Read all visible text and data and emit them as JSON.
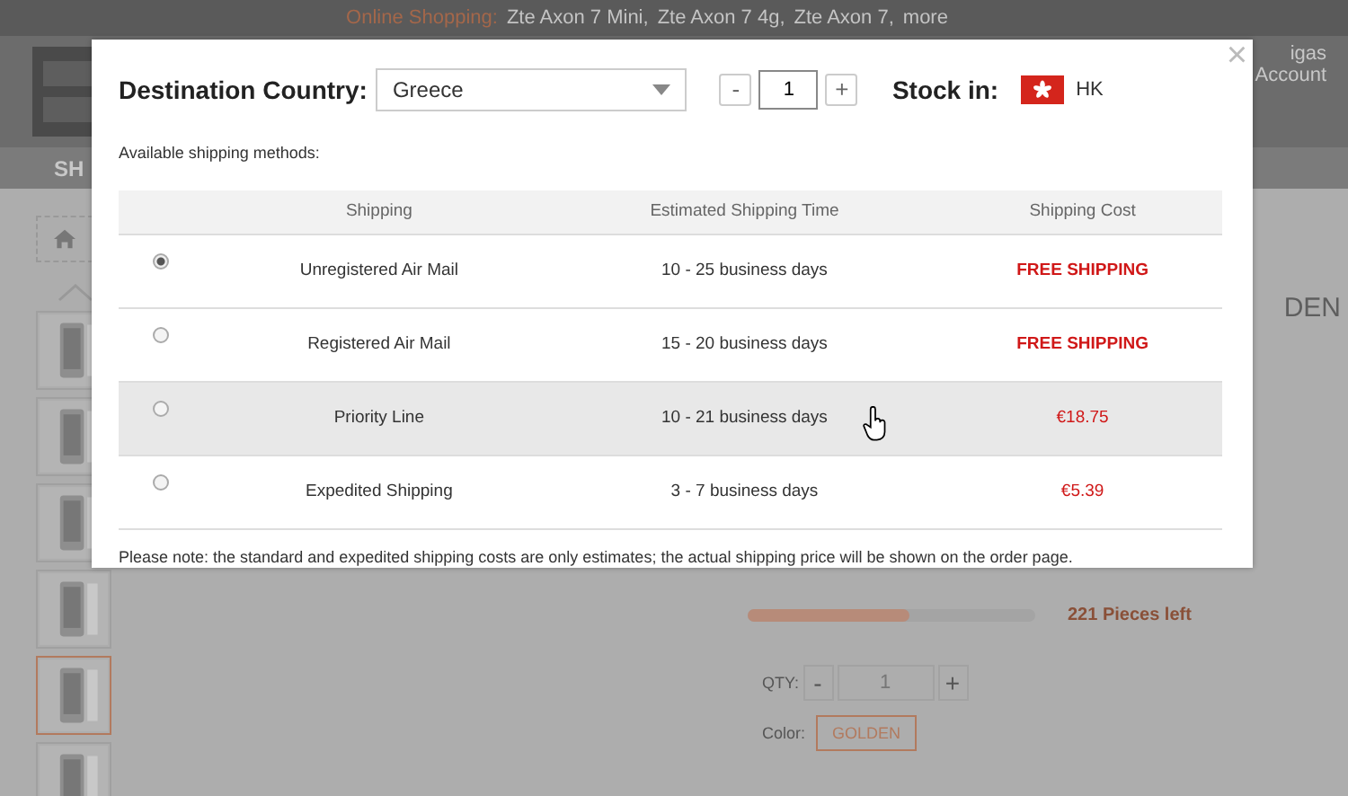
{
  "top_bar": {
    "label": "Online Shopping:",
    "links": [
      "Zte Axon 7 Mini,",
      "Zte Axon 7 4g,",
      "Zte Axon 7,",
      "more"
    ]
  },
  "header": {
    "account_lines": [
      "igas",
      "Account"
    ]
  },
  "nav": {
    "item": "SH"
  },
  "thumbnails": [
    {
      "selected": false
    },
    {
      "selected": false
    },
    {
      "selected": false
    },
    {
      "selected": false
    },
    {
      "selected": true
    },
    {
      "selected": false
    }
  ],
  "product": {
    "title_fragment": "DEN",
    "stock": {
      "level": 0.56,
      "reading": "221 Pieces left"
    },
    "qty": {
      "label": "QTY:",
      "minus": "-",
      "value": "1",
      "plus": "+"
    },
    "color": {
      "label": "Color:",
      "option": "GOLDEN"
    }
  },
  "dialog": {
    "close": "×",
    "country_label": "Destination Country:",
    "country": "Greece",
    "quantity": {
      "minus": "-",
      "value": "1",
      "plus": "+"
    },
    "stock_label": "Stock in:",
    "stock_location": "HK",
    "intro": "Available shipping methods:",
    "columns": [
      "Shipping",
      "Estimated Shipping Time",
      "Shipping Cost"
    ],
    "rows": [
      {
        "selected": true,
        "hovered": false,
        "name": "Unregistered Air Mail",
        "time": "10 - 25 business days",
        "cost": "FREE SHIPPING",
        "kind": "free"
      },
      {
        "selected": false,
        "hovered": false,
        "name": "Registered Air Mail",
        "time": "15 - 20 business days",
        "cost": "FREE SHIPPING",
        "kind": "free"
      },
      {
        "selected": false,
        "hovered": true,
        "name": "Priority Line",
        "time": "10 - 21 business days",
        "cost": "€18.75",
        "kind": "price"
      },
      {
        "selected": false,
        "hovered": false,
        "name": "Expedited Shipping",
        "time": "3 - 7 business days",
        "cost": "€5.39",
        "kind": "price"
      }
    ],
    "note": "Please note: the standard and expedited shipping costs are only estimates; the actual shipping price will be shown on the order page."
  }
}
